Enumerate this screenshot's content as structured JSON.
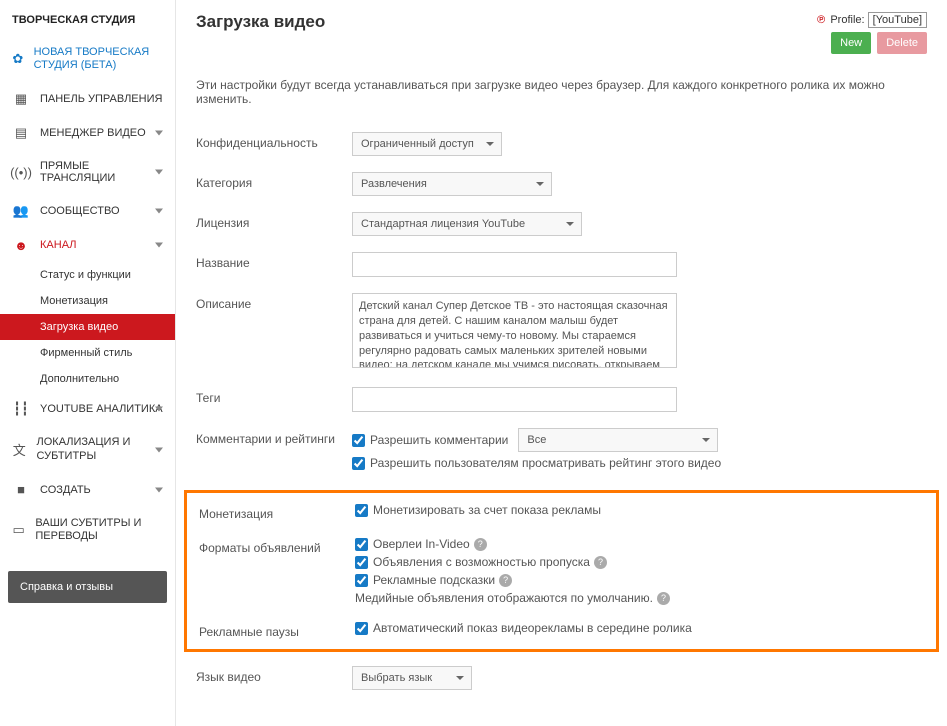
{
  "sidebar": {
    "title": "ТВОРЧЕСКАЯ СТУДИЯ",
    "newStudio": "НОВАЯ ТВОРЧЕСКАЯ СТУДИЯ (БЕТА)",
    "dashboard": "ПАНЕЛЬ УПРАВЛЕНИЯ",
    "videoManager": "МЕНЕДЖЕР ВИДЕО",
    "liveStream": "ПРЯМЫЕ ТРАНСЛЯЦИИ",
    "community": "СООБЩЕСТВО",
    "channel": "КАНАЛ",
    "channelSubs": {
      "status": "Статус и функции",
      "monetization": "Монетизация",
      "upload": "Загрузка видео",
      "branding": "Фирменный стиль",
      "advanced": "Дополнительно"
    },
    "analytics": "YOUTUBE АНАЛИТИКА",
    "translations": "ЛОКАЛИЗАЦИЯ И СУБТИТРЫ",
    "create": "СОЗДАТЬ",
    "yourSubs": "ВАШИ СУБТИТРЫ И ПЕРЕВОДЫ",
    "feedback": "Справка и отзывы"
  },
  "header": {
    "title": "Загрузка видео",
    "profileLabel": "Profile:",
    "profileValue": "[YouTube]",
    "new": "New",
    "delete": "Delete"
  },
  "description": "Эти настройки будут всегда устанавливаться при загрузке видео через браузер. Для каждого конкретного ролика их можно изменить.",
  "form": {
    "privacy": {
      "label": "Конфиденциальность",
      "value": "Ограниченный доступ"
    },
    "category": {
      "label": "Категория",
      "value": "Развлечения"
    },
    "license": {
      "label": "Лицензия",
      "value": "Стандартная лицензия YouTube"
    },
    "videoTitle": {
      "label": "Название"
    },
    "descField": {
      "label": "Описание",
      "value": "Детский канал Супер Детское ТВ - это настоящая сказочная страна для детей. С нашим каналом малыш будет развиваться и учиться чему-то новому. Мы стараемся регулярно радовать самых маленьких зрителей новыми видео: на детском канале мы учимся рисовать, открываем киндеры, делаем DIY(поделки), а также обзоры на игрушки из"
    },
    "tags": {
      "label": "Теги"
    },
    "comments": {
      "label": "Комментарии и рейтинги",
      "allow": "Разрешить комментарии",
      "filter": "Все",
      "ratings": "Разрешить пользователям просматривать рейтинг этого видео"
    },
    "monetization": {
      "label": "Монетизация",
      "option": "Монетизировать за счет показа рекламы"
    },
    "adFormats": {
      "label": "Форматы объявлений",
      "overlay": "Оверлеи In-Video",
      "skippable": "Объявления с возможностью пропуска",
      "sponsored": "Рекламные подсказки",
      "display": "Медийные объявления отображаются по умолчанию."
    },
    "adBreaks": {
      "label": "Рекламные паузы",
      "option": "Автоматический показ видеорекламы в середине ролика"
    },
    "language": {
      "label": "Язык видео",
      "value": "Выбрать язык"
    }
  }
}
